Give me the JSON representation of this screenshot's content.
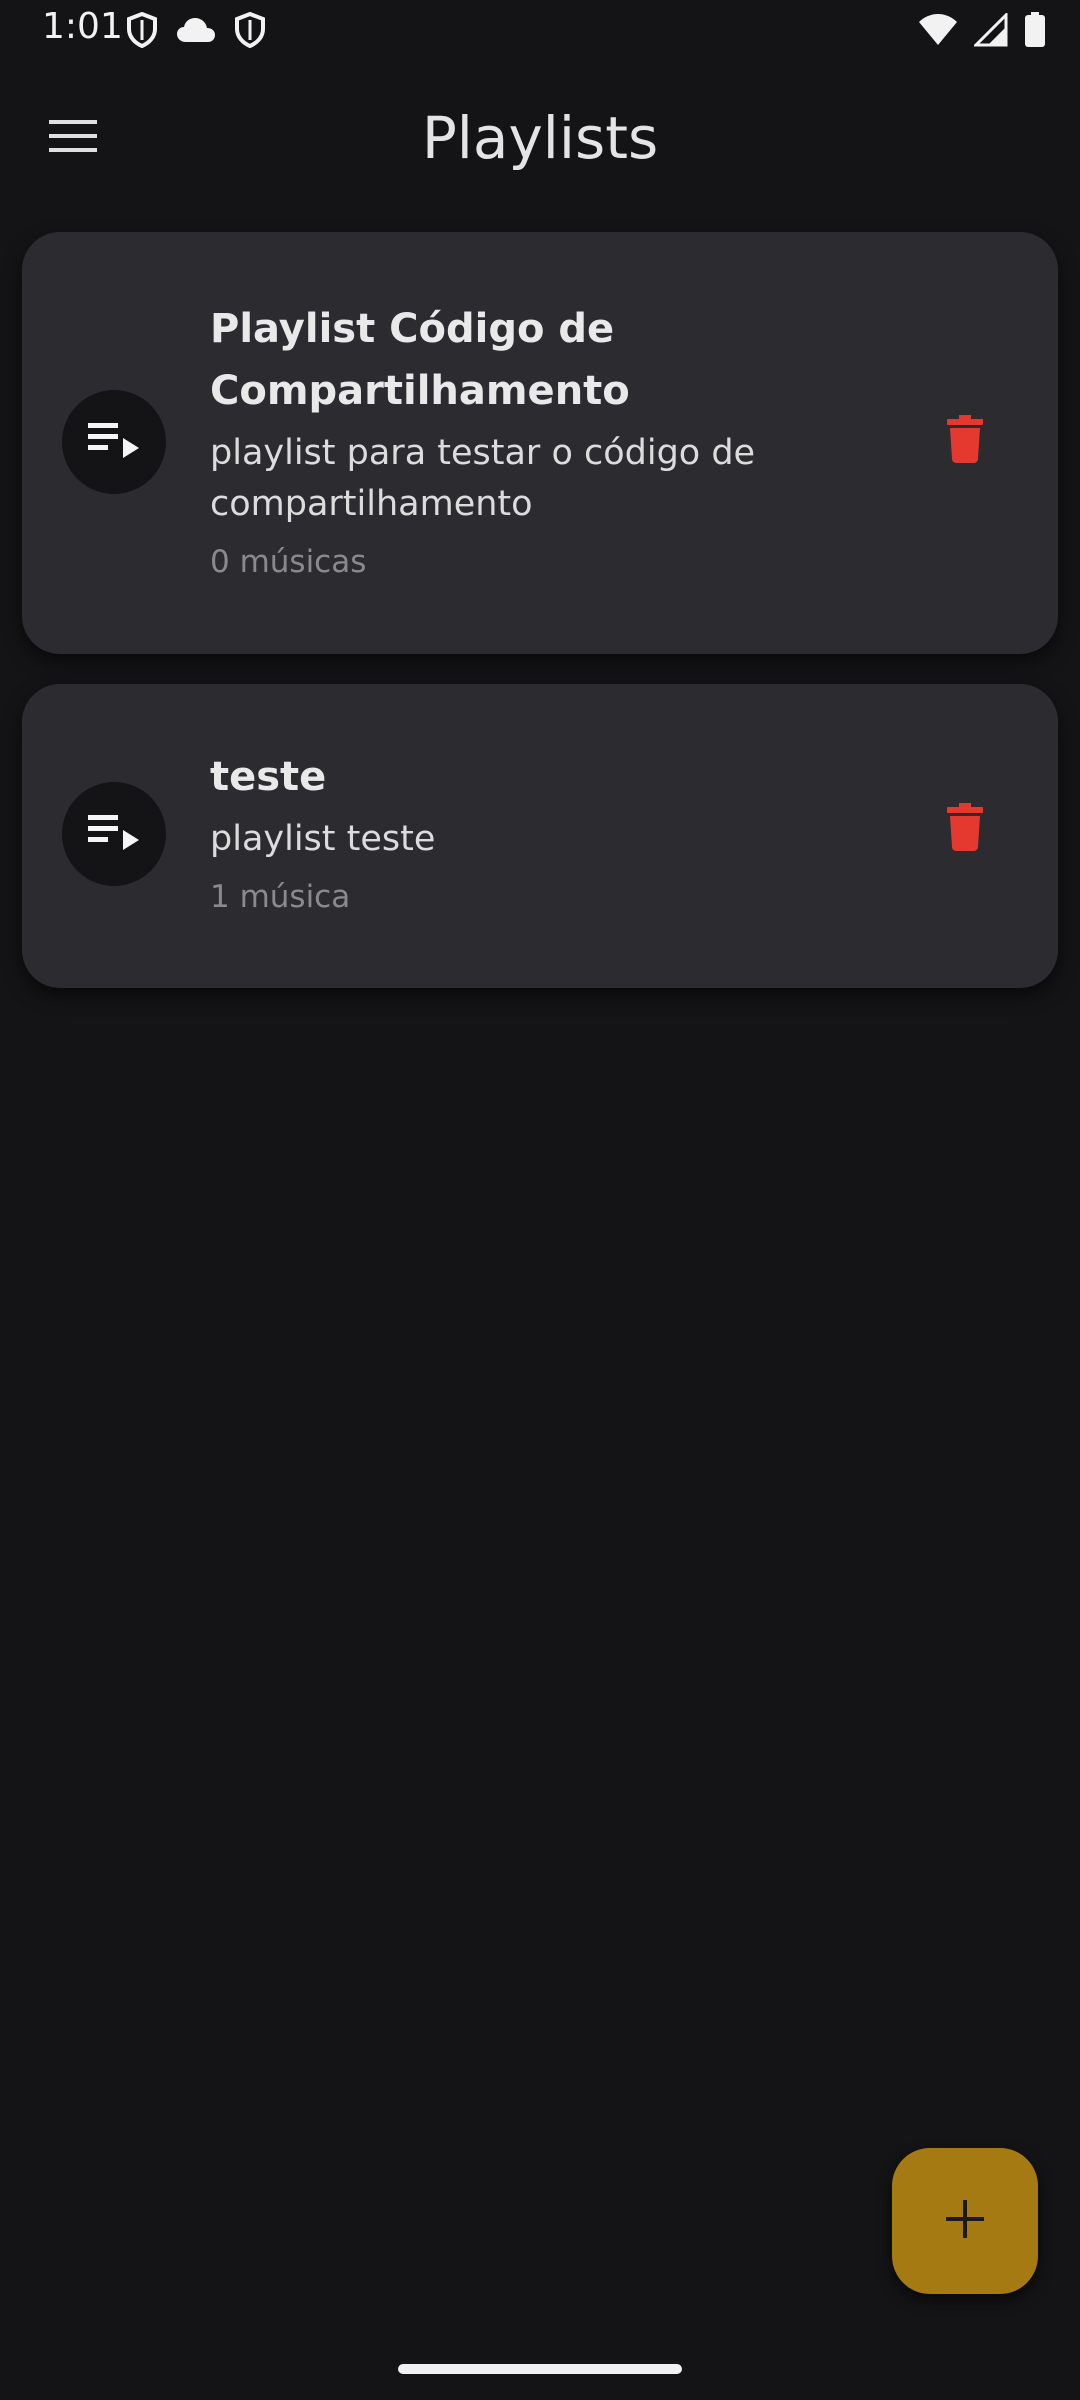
{
  "status_bar": {
    "time": "1:01",
    "left_icons": [
      "shield-icon",
      "cloud-icon",
      "shield-icon"
    ],
    "right_icons": [
      "wifi-icon",
      "cellular-signal-icon",
      "battery-icon"
    ]
  },
  "app_bar": {
    "title": "Playlists",
    "menu_icon": "hamburger-menu-icon"
  },
  "playlists": [
    {
      "title": "Playlist Código de Compartilhamento",
      "description": "playlist para testar o código de compartilhamento",
      "count": "0 músicas",
      "icon": "playlist-play-icon",
      "delete_icon": "trash-icon"
    },
    {
      "title": "teste",
      "description": "playlist teste",
      "count": "1 música",
      "icon": "playlist-play-icon",
      "delete_icon": "trash-icon"
    }
  ],
  "fab": {
    "icon": "plus-icon"
  },
  "colors": {
    "background": "#141416",
    "card": "#2b2b30",
    "delete": "#e5392f",
    "fab": "#a57a13"
  }
}
